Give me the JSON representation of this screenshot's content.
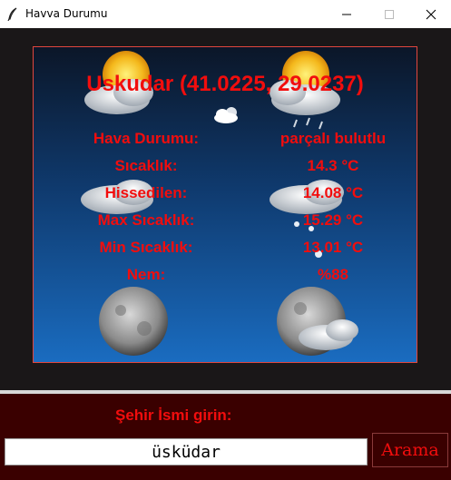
{
  "window": {
    "title": "Havva Durumu"
  },
  "weather": {
    "city_heading": "Uskudar (41.0225, 29.0237)",
    "icon": "partly-cloudy-icon",
    "rows": [
      {
        "label": "Hava Durumu:",
        "value": "parçalı bulutlu"
      },
      {
        "label": "Sıcaklık:",
        "value": "14.3 °C"
      },
      {
        "label": "Hissedilen:",
        "value": "14.08 °C"
      },
      {
        "label": "Max Sıcaklık:",
        "value": "15.29 °C"
      },
      {
        "label": "Min Sıcaklık:",
        "value": "13.01 °C"
      },
      {
        "label": "Nem:",
        "value": "%88"
      }
    ]
  },
  "form": {
    "label": "Şehir İsmi girin:",
    "input_value": "üsküdar",
    "button_label": "Arama"
  },
  "colors": {
    "accent_text": "#f20d0d",
    "panel_border": "#e2463e",
    "form_background": "#3a0000",
    "window_background": "#1a1718"
  }
}
